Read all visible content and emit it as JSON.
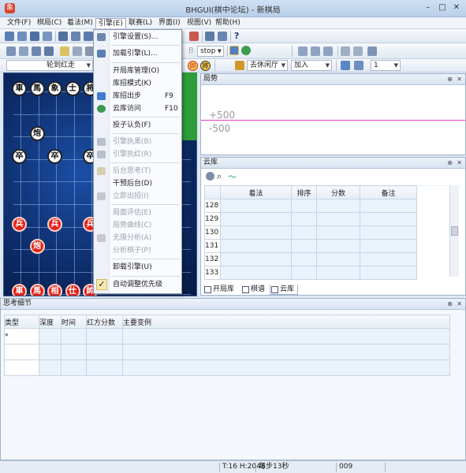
{
  "window": {
    "title": "BHGUI(棋中论坛) - 新棋局"
  },
  "menubar": [
    "文件(F)",
    "棋局(C)",
    "着法(M)",
    "引擎(E)",
    "联赛(L)",
    "界面(I)",
    "视图(V)",
    "帮助(H)"
  ],
  "toolbar": {
    "stop_combo": "stop",
    "hint_combo": "轮到红走",
    "mode_combo": "去休闲厅",
    "action_combo": "加入",
    "counter_combo": "1",
    "ghost_letter": "B"
  },
  "engine_menu": {
    "items": [
      {
        "label": "引擎设置(S)...",
        "shortcut": "",
        "enabled": true,
        "icon": "engine-settings-icon"
      },
      {
        "label": "加载引擎(L)...",
        "shortcut": "",
        "enabled": true,
        "icon": "load-engine-icon"
      },
      {
        "label": "开局库管理(O)",
        "shortcut": "",
        "enabled": true,
        "icon": ""
      },
      {
        "label": "库招模式(K)",
        "shortcut": "",
        "enabled": true,
        "icon": ""
      },
      {
        "label": "库招出步",
        "shortcut": "F9",
        "enabled": true,
        "icon": "book-move-icon"
      },
      {
        "label": "云库访问",
        "shortcut": "F10",
        "enabled": true,
        "icon": "cloud-library-icon"
      },
      {
        "label": "投子认负(F)",
        "shortcut": "",
        "enabled": true,
        "icon": ""
      },
      {
        "label": "引擎执黑(B)",
        "shortcut": "",
        "enabled": false,
        "icon": "engine-black-icon"
      },
      {
        "label": "引擎执红(R)",
        "shortcut": "",
        "enabled": false,
        "icon": "engine-red-icon"
      },
      {
        "label": "后台思考(T)",
        "shortcut": "",
        "enabled": false,
        "icon": "ponder-icon"
      },
      {
        "label": "干预后台(D)",
        "shortcut": "",
        "enabled": true,
        "icon": ""
      },
      {
        "label": "立即出招(I)",
        "shortcut": "",
        "enabled": false,
        "icon": "move-now-icon"
      },
      {
        "label": "局面评估(E)",
        "shortcut": "",
        "enabled": false,
        "icon": ""
      },
      {
        "label": "局势曲线(C)",
        "shortcut": "",
        "enabled": false,
        "icon": ""
      },
      {
        "label": "无限分析(A)",
        "shortcut": "",
        "enabled": false,
        "icon": "infinite-analysis-icon"
      },
      {
        "label": "分析棋子(P)",
        "shortcut": "",
        "enabled": false,
        "icon": ""
      },
      {
        "label": "卸载引擎(U)",
        "shortcut": "",
        "enabled": true,
        "icon": ""
      },
      {
        "label": "自动调整优先级",
        "shortcut": "",
        "enabled": true,
        "icon": "checkmark-icon"
      }
    ],
    "check_glyph": "✓"
  },
  "board": {
    "pieces": [
      {
        "char": "車",
        "side": "black",
        "col": 0,
        "row": 0
      },
      {
        "char": "馬",
        "side": "black",
        "col": 1,
        "row": 0
      },
      {
        "char": "象",
        "side": "black",
        "col": 2,
        "row": 0
      },
      {
        "char": "士",
        "side": "black",
        "col": 3,
        "row": 0
      },
      {
        "char": "將",
        "side": "black",
        "col": 4,
        "row": 0
      },
      {
        "char": "炮",
        "side": "black",
        "col": 1,
        "row": 2
      },
      {
        "char": "卒",
        "side": "black",
        "col": 0,
        "row": 3
      },
      {
        "char": "卒",
        "side": "black",
        "col": 2,
        "row": 3
      },
      {
        "char": "卒",
        "side": "black",
        "col": 4,
        "row": 3
      },
      {
        "char": "兵",
        "side": "red",
        "col": 0,
        "row": 6
      },
      {
        "char": "兵",
        "side": "red",
        "col": 2,
        "row": 6
      },
      {
        "char": "兵",
        "side": "red",
        "col": 4,
        "row": 6
      },
      {
        "char": "炮",
        "side": "red",
        "col": 1,
        "row": 7
      },
      {
        "char": "車",
        "side": "red",
        "col": 0,
        "row": 9
      },
      {
        "char": "馬",
        "side": "red",
        "col": 1,
        "row": 9
      },
      {
        "char": "相",
        "side": "red",
        "col": 2,
        "row": 9
      },
      {
        "char": "仕",
        "side": "red",
        "col": 3,
        "row": 9
      },
      {
        "char": "帥",
        "side": "red",
        "col": 4,
        "row": 9
      }
    ]
  },
  "situation_panel": {
    "title": "局势",
    "upper_label": "+500",
    "lower_label": "-500"
  },
  "cloud_panel": {
    "title": "云库",
    "columns": [
      "着法",
      "排序",
      "分数",
      "备注"
    ],
    "rows": [
      "128",
      "129",
      "130",
      "131",
      "132",
      "133"
    ],
    "tabs": [
      "开局库",
      "棋谱",
      "云库"
    ]
  },
  "thinking_panel": {
    "title": "思考细节",
    "columns": [
      "类型",
      "深度",
      "时间",
      "红方分数",
      "主要变例"
    ],
    "first_cell": "*"
  },
  "statusbar": {
    "hash": "T:16 H:2048",
    "step_time": "每步13秒",
    "move_no": "009"
  },
  "colors": {
    "board_bg": "#0c2a66",
    "red_piece": "#e32117",
    "eval_line": "#e040c0",
    "grid_row": "#eaf2fc"
  }
}
